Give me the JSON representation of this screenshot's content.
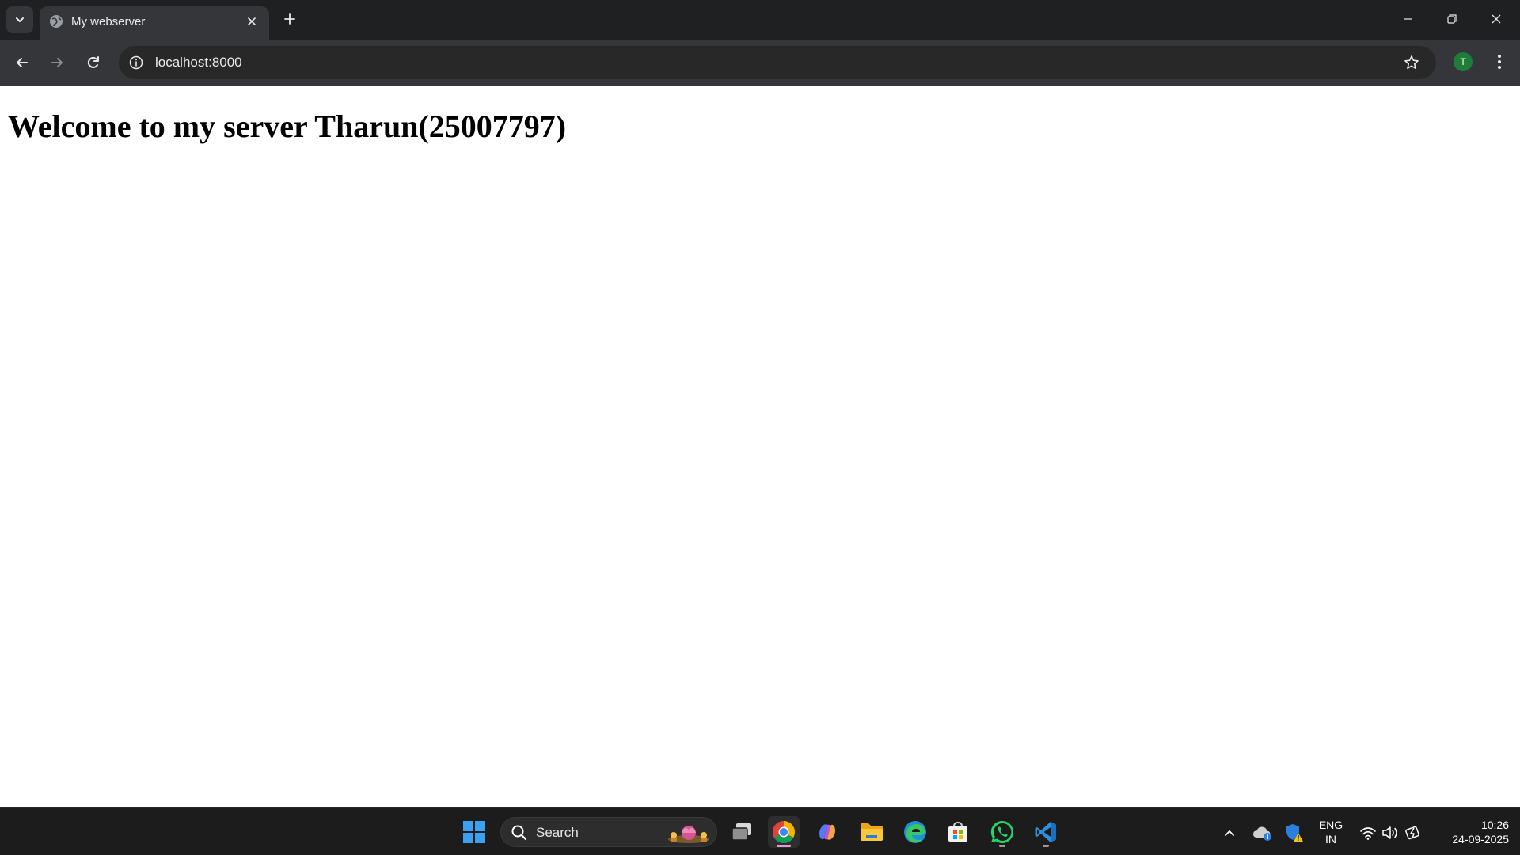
{
  "browser": {
    "tab": {
      "title": "My webserver"
    },
    "address_bar": {
      "url": "localhost:8000"
    },
    "profile": {
      "initial": "T",
      "color": "#1e7d36"
    }
  },
  "page": {
    "heading": "Welcome to my server Tharun(25007797)"
  },
  "taskbar": {
    "search_label": "Search",
    "apps": [
      {
        "name": "start",
        "icon": "windows-logo-icon"
      },
      {
        "name": "task-view",
        "icon": "task-view-icon"
      },
      {
        "name": "chrome",
        "icon": "chrome-icon",
        "active": true
      },
      {
        "name": "copilot",
        "icon": "copilot-icon"
      },
      {
        "name": "file-explorer",
        "icon": "folder-icon"
      },
      {
        "name": "edge",
        "icon": "edge-icon"
      },
      {
        "name": "store",
        "icon": "store-icon"
      },
      {
        "name": "whatsapp",
        "icon": "whatsapp-icon",
        "running": true
      },
      {
        "name": "vscode",
        "icon": "vscode-icon",
        "running": true
      }
    ],
    "tray": {
      "language_line1": "ENG",
      "language_line2": "IN",
      "time": "10:26",
      "date": "24-09-2025"
    }
  },
  "colors": {
    "chrome_frame": "#1f2022",
    "chrome_toolbar": "#35363a",
    "taskbar": "#1c1c1c",
    "accent_indicator": "#e49ad8"
  }
}
